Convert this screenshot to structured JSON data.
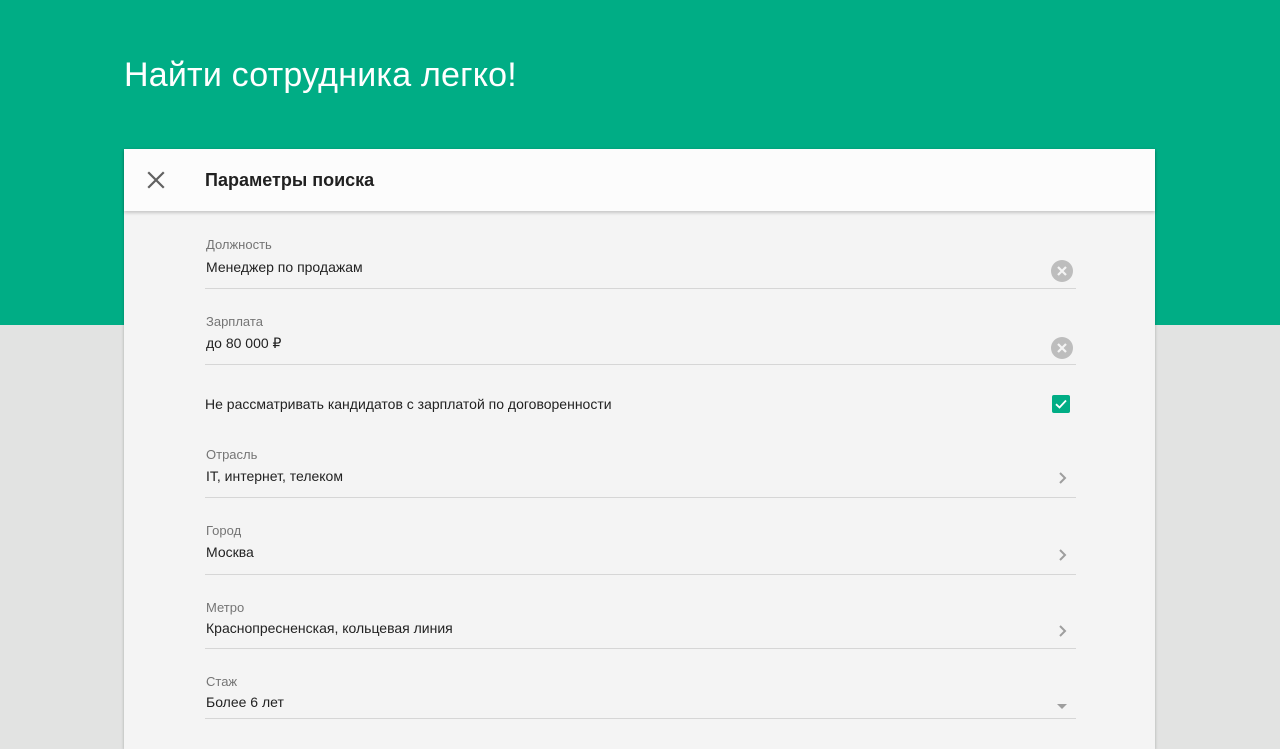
{
  "hero": {
    "title": "Найти сотрудника легко!"
  },
  "card": {
    "title": "Параметры поиска",
    "close_icon": "close-icon"
  },
  "fields": {
    "position": {
      "label": "Должность",
      "value": "Менеджер по продажам",
      "icon": "clear-icon"
    },
    "salary": {
      "label": "Зарплата",
      "value": "до 80 000 ₽",
      "icon": "clear-icon"
    },
    "negotiable": {
      "label": "Не рассматривать кандидатов с зарплатой по договоренности",
      "checked": true
    },
    "industry": {
      "label": "Отрасль",
      "value": "IT, интернет, телеком",
      "icon": "chevron-right-icon"
    },
    "city": {
      "label": "Город",
      "value": "Москва",
      "icon": "chevron-right-icon"
    },
    "metro": {
      "label": "Метро",
      "value": "Краснопресненская, кольцевая линия",
      "icon": "chevron-right-icon"
    },
    "experience": {
      "label": "Стаж",
      "value": "Более 6 лет",
      "icon": "dropdown-arrow-icon"
    }
  },
  "colors": {
    "accent": "#00ad85",
    "background": "#e2e3e2",
    "card": "#f4f4f4",
    "icon_gray": "#bdbdbd"
  }
}
